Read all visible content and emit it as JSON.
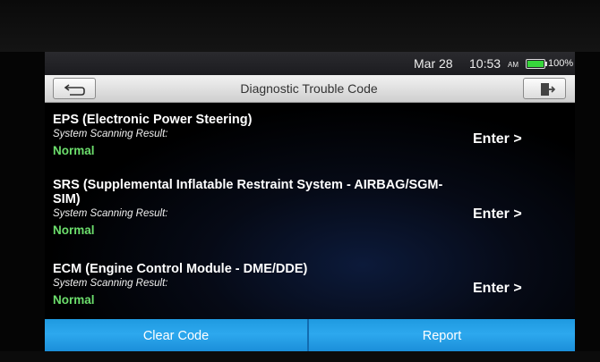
{
  "status": {
    "date": "Mar 28",
    "time": "10:53",
    "ampm": "AM",
    "battery_percent": "100%",
    "battery_level": 1.0
  },
  "header": {
    "title": "Diagnostic Trouble Code",
    "back_icon": "back-arrow-icon",
    "exit_icon": "exit-door-icon"
  },
  "systems": [
    {
      "name": "EPS (Electronic Power Steering)",
      "sub": "System Scanning Result:",
      "result": "Normal",
      "action": "Enter >"
    },
    {
      "name": "SRS (Supplemental Inflatable Restraint System - AIRBAG/SGM-SIM)",
      "sub": "System Scanning Result:",
      "result": "Normal",
      "action": "Enter >"
    },
    {
      "name": "ECM (Engine Control Module - DME/DDE)",
      "sub": "System Scanning Result:",
      "result": "Normal",
      "action": "Enter >"
    }
  ],
  "actions": {
    "clear": "Clear Code",
    "report": "Report"
  },
  "colors": {
    "accent": "#2da8ee",
    "result_ok": "#6cde6c",
    "battery": "#37d63c"
  }
}
